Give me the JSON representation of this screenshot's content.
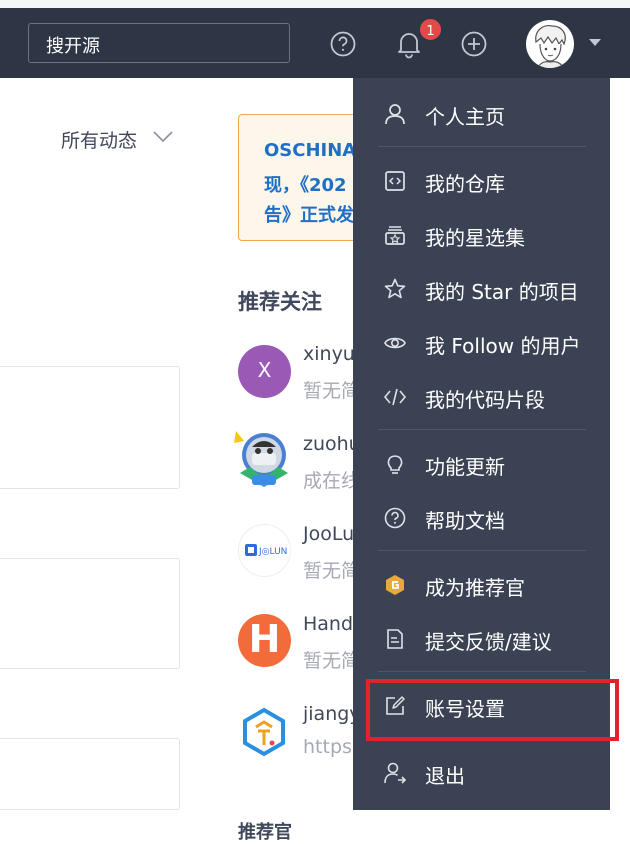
{
  "header": {
    "search_placeholder": "搜开源",
    "notification_count": "1",
    "icons": [
      "help-icon",
      "bell-icon",
      "plus-icon",
      "avatar",
      "chevron-down-icon"
    ]
  },
  "feed": {
    "filter_label": "所有动态"
  },
  "sidebar": {
    "notice_lines": [
      "OSCHINA",
      "现，《202",
      "告》正式发"
    ],
    "recommend_title": "推荐关注",
    "recommendations": [
      {
        "name": "xinyu",
        "subtitle": "暂无简",
        "avatar_letter": "X",
        "avatar_color": "#9b59b6"
      },
      {
        "name": "zuohu",
        "subtitle": "成在线",
        "avatar_letter": "",
        "avatar_color": "#4a7fd4"
      },
      {
        "name": "JooLu",
        "subtitle": "暂无简",
        "avatar_letter": "",
        "avatar_color": "#ffffff"
      },
      {
        "name": "Handy",
        "subtitle": "暂无简",
        "avatar_letter": "H",
        "avatar_color": "#f26b3a"
      },
      {
        "name": "jiangy",
        "subtitle": "https:",
        "avatar_letter": "",
        "avatar_color": "#ffffff"
      }
    ],
    "bottom_title": "推荐官"
  },
  "dropdown": {
    "items": [
      {
        "label": "个人主页",
        "icon": "user-icon"
      },
      {
        "label": "我的仓库",
        "icon": "repo-icon"
      },
      {
        "label": "我的星选集",
        "icon": "star-collection-icon"
      },
      {
        "label": "我的 Star 的项目",
        "icon": "star-icon"
      },
      {
        "label": "我 Follow 的用户",
        "icon": "eye-icon"
      },
      {
        "label": "我的代码片段",
        "icon": "code-icon"
      },
      {
        "label": "功能更新",
        "icon": "lightbulb-icon"
      },
      {
        "label": "帮助文档",
        "icon": "help-icon"
      },
      {
        "label": "成为推荐官",
        "icon": "recommender-badge-icon"
      },
      {
        "label": "提交反馈/建议",
        "icon": "feedback-icon"
      },
      {
        "label": "账号设置",
        "icon": "edit-icon"
      },
      {
        "label": "退出",
        "icon": "logout-icon"
      }
    ]
  },
  "colors": {
    "topbar": "#2e3545",
    "dropdown": "#3b4253",
    "highlight": "#e3232c",
    "link": "#1f6fc6",
    "badge": "#e24a4a"
  }
}
